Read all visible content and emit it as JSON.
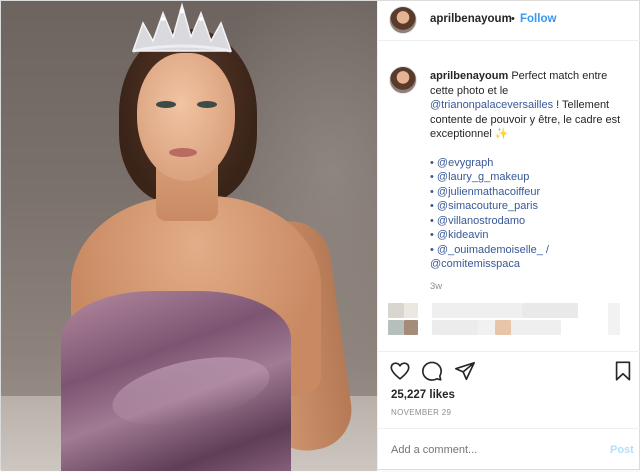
{
  "post": {
    "username": "aprilbenayoum",
    "separator": "•",
    "follow_label": "Follow",
    "caption": {
      "username": "aprilbenayoum",
      "text_1": "Perfect match entre cette photo et le",
      "link_1": "@trianonpalaceversailles",
      "text_2": "! Tellement contente de pouvoir y être, le cadre est exceptionnel",
      "sparkle": "✨",
      "mentions": [
        "• @evygraph",
        "• @laury_g_makeup",
        "• @julienmathacoiffeur",
        "• @simacouture_paris",
        "• @villanostrodamo",
        "• @kideavin",
        "• @_ouimademoiselle_ /",
        "@comitemisspaca"
      ]
    },
    "time_ago": "3w",
    "likes": "25,227 likes",
    "date": "NOVEMBER 29",
    "comment_placeholder": "Add a comment...",
    "post_button": "Post"
  },
  "icons": {
    "like": "heart-icon",
    "comment": "speech-bubble-icon",
    "share": "paper-plane-icon",
    "save": "bookmark-icon"
  },
  "colors": {
    "link": "#385898",
    "follow": "#3897f0",
    "muted": "#8e8e8e",
    "post_button_disabled": "#b2dffc"
  }
}
